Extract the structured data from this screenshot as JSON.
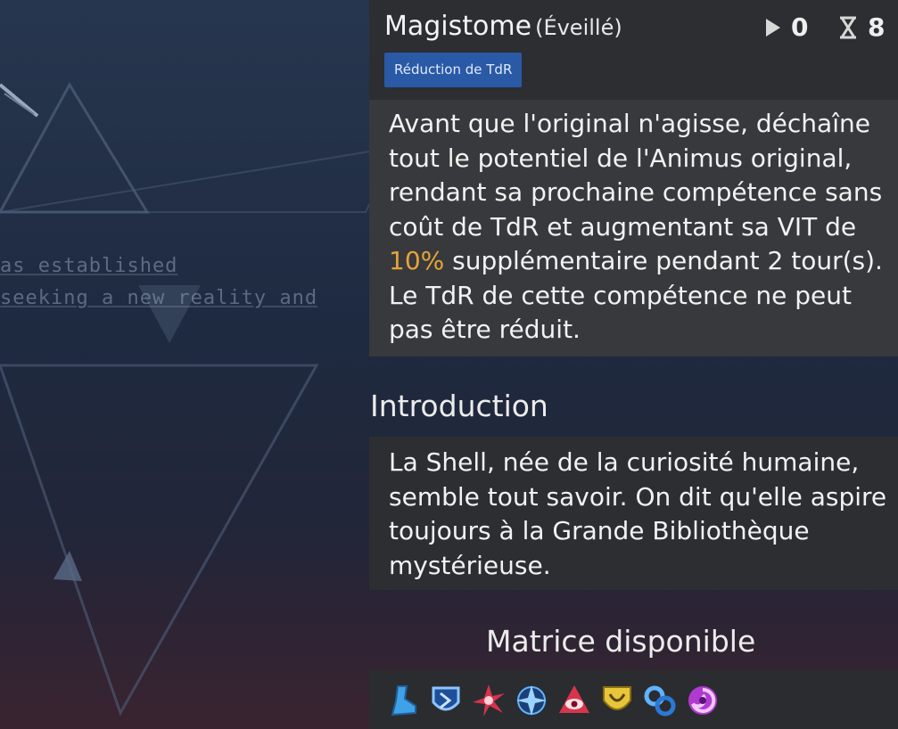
{
  "skill": {
    "name": "Magistome",
    "state": "(Éveillé)",
    "play_count": "0",
    "hourglass_count": "8",
    "tag": "Réduction de TdR",
    "description_before": "Avant que l'original n'agisse, déchaîne tout le potentiel de l'Animus original, rendant sa prochaine compétence sans coût de TdR et augmentant sa VIT de ",
    "description_highlight": "10%",
    "description_after": " supplémentaire pendant 2 tour(s). Le TdR de cette compétence ne peut pas être réduit."
  },
  "introduction": {
    "title": "Introduction",
    "text": "La Shell, née de la curiosité humaine, semble tout savoir. On dit qu'elle aspire toujours à la Grande Bibliothèque mystérieuse."
  },
  "matrix": {
    "title": "Matrice disponible",
    "icons": [
      "boot-icon",
      "shield-chevron-icon",
      "spiked-star-icon",
      "compass-star-icon",
      "eye-triangle-icon",
      "gold-shield-icon",
      "linked-rings-icon",
      "swirl-icon"
    ]
  },
  "background": {
    "line1": "as established",
    "line2": "seeking a new reality and"
  },
  "colors": {
    "highlight": "#e5a43a",
    "tag_bg": "#2a59a6"
  }
}
